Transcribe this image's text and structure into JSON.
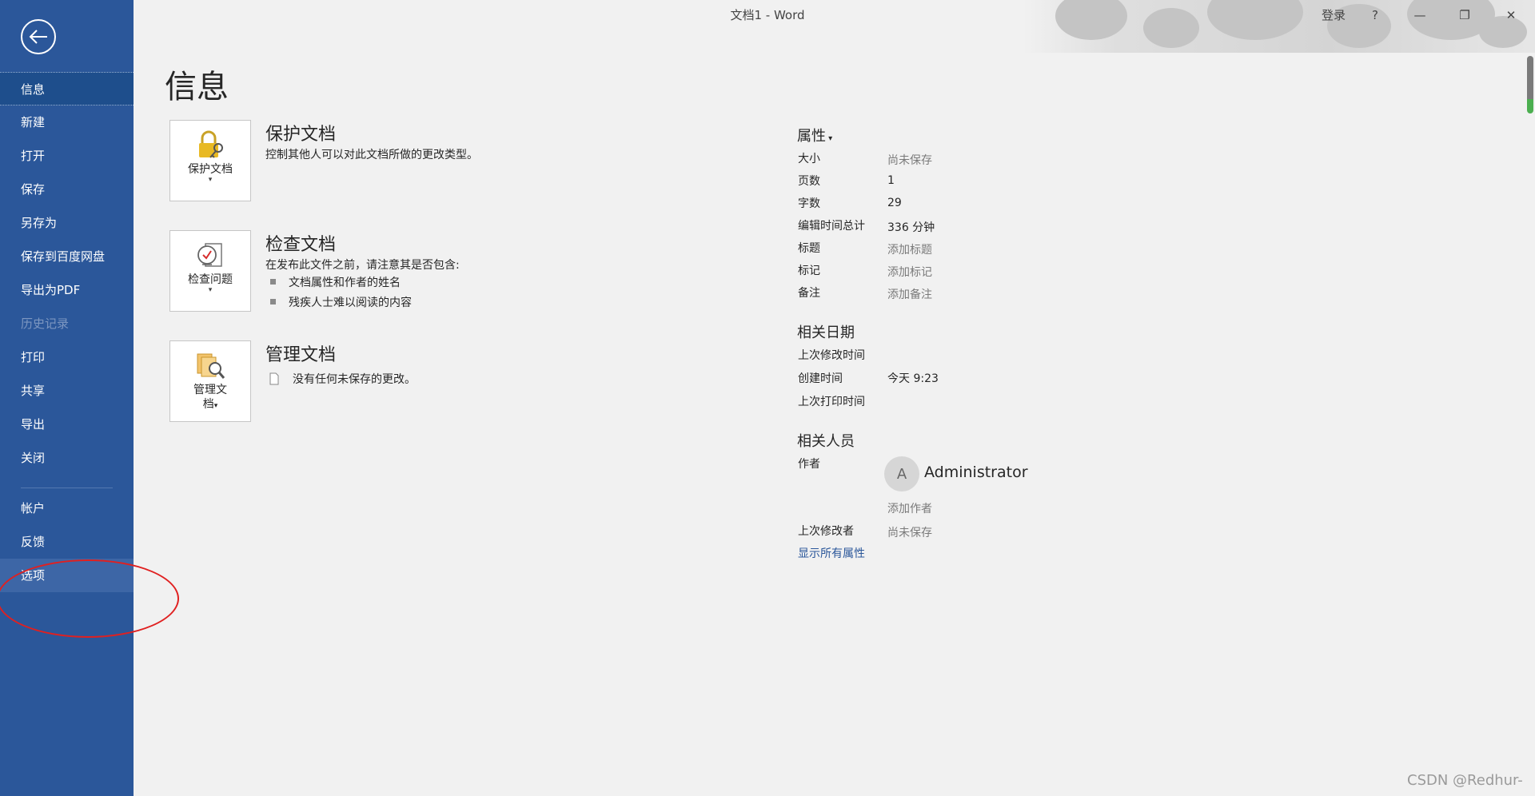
{
  "window": {
    "title": "文档1  -  Word",
    "sign_in": "登录",
    "help": "?",
    "minimize": "—",
    "restore": "❐",
    "close": "✕"
  },
  "nav": {
    "items": [
      {
        "label": "信息",
        "state": "active"
      },
      {
        "label": "新建"
      },
      {
        "label": "打开"
      },
      {
        "label": "保存"
      },
      {
        "label": "另存为"
      },
      {
        "label": "保存到百度网盘"
      },
      {
        "label": "导出为PDF"
      },
      {
        "label": "历史记录",
        "state": "disabled"
      },
      {
        "label": "打印"
      },
      {
        "label": "共享"
      },
      {
        "label": "导出"
      },
      {
        "label": "关闭"
      }
    ],
    "bottom_items": [
      {
        "label": "帐户"
      },
      {
        "label": "反馈"
      },
      {
        "label": "选项",
        "state": "hover"
      }
    ]
  },
  "main": {
    "title": "信息",
    "protect": {
      "card_label": "保护文档",
      "title": "保护文档",
      "desc": "控制其他人可以对此文档所做的更改类型。"
    },
    "inspect": {
      "card_label": "检查问题",
      "title": "检查文档",
      "desc": "在发布此文件之前，请注意其是否包含:",
      "bullets": [
        "文档属性和作者的姓名",
        "残疾人士难以阅读的内容"
      ]
    },
    "manage": {
      "card_label_line1": "管理文",
      "card_label_line2": "档",
      "title": "管理文档",
      "desc": "没有任何未保存的更改。"
    }
  },
  "properties": {
    "header": "属性",
    "rows": [
      {
        "label": "大小",
        "value": "尚未保存",
        "muted": true
      },
      {
        "label": "页数",
        "value": "1"
      },
      {
        "label": "字数",
        "value": "29"
      },
      {
        "label": "编辑时间总计",
        "value": "336 分钟"
      },
      {
        "label": "标题",
        "value": "添加标题",
        "muted": true
      },
      {
        "label": "标记",
        "value": "添加标记",
        "muted": true
      },
      {
        "label": "备注",
        "value": "添加备注",
        "muted": true
      }
    ],
    "dates_header": "相关日期",
    "dates": [
      {
        "label": "上次修改时间",
        "value": ""
      },
      {
        "label": "创建时间",
        "value": "今天 9:23"
      },
      {
        "label": "上次打印时间",
        "value": ""
      }
    ],
    "people_header": "相关人员",
    "author_label": "作者",
    "author_initial": "A",
    "author_name": "Administrator",
    "add_author": "添加作者",
    "last_modified_by_label": "上次修改者",
    "last_modified_by_value": "尚未保存",
    "show_all": "显示所有属性"
  },
  "watermark": "CSDN @Redhur-",
  "colors": {
    "nav_bg": "#2b579a",
    "link": "#2b579a",
    "annotation": "#e02020"
  }
}
